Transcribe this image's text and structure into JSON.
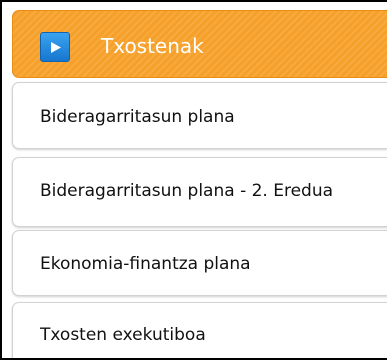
{
  "header": {
    "label": "Txostenak",
    "icon": "play-arrow-icon",
    "bg_color": "#f6a02a",
    "icon_color": "#1f84dc"
  },
  "items": [
    {
      "label": "Bideragarritasun plana"
    },
    {
      "label": "Bideragarritasun plana - 2. Eredua"
    },
    {
      "label": "Ekonomia-finantza plana"
    },
    {
      "label": "Txosten exekutiboa"
    }
  ]
}
